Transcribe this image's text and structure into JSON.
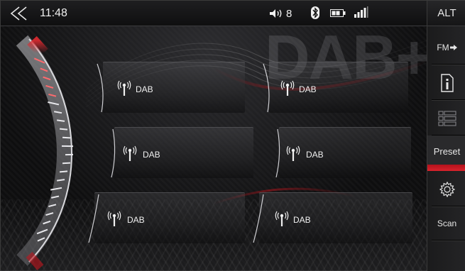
{
  "status_bar": {
    "time": "11:48",
    "volume_level": "8",
    "icons": [
      "back-chevron-icon",
      "volume-icon",
      "bluetooth-icon",
      "battery-icon",
      "signal-icon"
    ]
  },
  "logo": {
    "text": "DAB+"
  },
  "presets": [
    {
      "label": "DAB"
    },
    {
      "label": "DAB"
    },
    {
      "label": "DAB"
    },
    {
      "label": "DAB"
    },
    {
      "label": "DAB"
    },
    {
      "label": "DAB"
    }
  ],
  "side_menu": {
    "alt_label": "ALT",
    "fm_label": "FM",
    "preset_label": "Preset",
    "scan_label": "Scan",
    "active_item": "Preset"
  },
  "colors": {
    "accent": "#d9232c",
    "background": "#0c0c0d",
    "text": "#e8e8e8"
  }
}
